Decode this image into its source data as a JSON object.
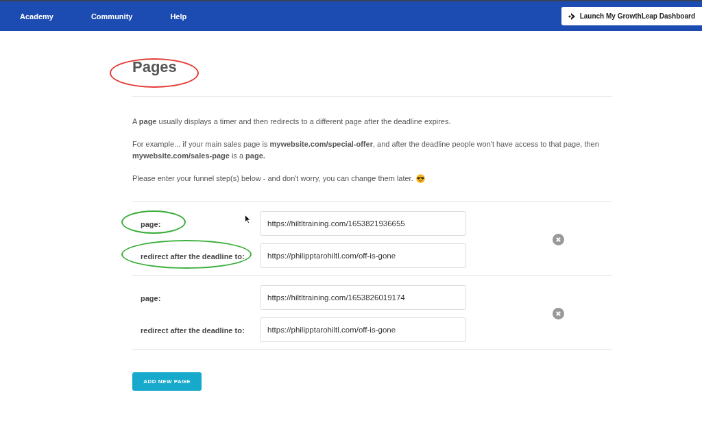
{
  "nav": {
    "items": [
      {
        "label": "Academy"
      },
      {
        "label": "Community"
      },
      {
        "label": "Help"
      }
    ],
    "dashboard_button": "Launch My GrowthLeap Dashboard"
  },
  "title": {
    "text": "Pages",
    "color": "#e53935"
  },
  "intro": [
    "A **page** usually displays a timer and then redirects to a different page after the deadline expires.",
    "For example... if your main sales page is **mywebsite.com/special-offer**, and after the deadline people won't have access to that page, then  **mywebsite.com/sales-page** is a **page.**",
    "Please enter your funnel step(s) below - and don't worry, you can change them later."
  ],
  "steps": [
    {
      "fields": [
        {
          "label": "page:",
          "value": "https://hiltltraining.com/1653821936655",
          "color": "#3aae3a"
        },
        {
          "label": "redirect after the deadline to:",
          "value": "https://philipptarohiltl.com/off-is-gone",
          "color": "#3aae3a"
        }
      ]
    },
    {
      "fields": [
        {
          "label": "page:",
          "value": "https://hiltltraining.com/1653826019174"
        },
        {
          "label": "redirect after the deadline to:",
          "value": "https://philipptarohiltl.com/off-is-gone"
        }
      ]
    }
  ],
  "add_button": "ADD NEW PAGE"
}
